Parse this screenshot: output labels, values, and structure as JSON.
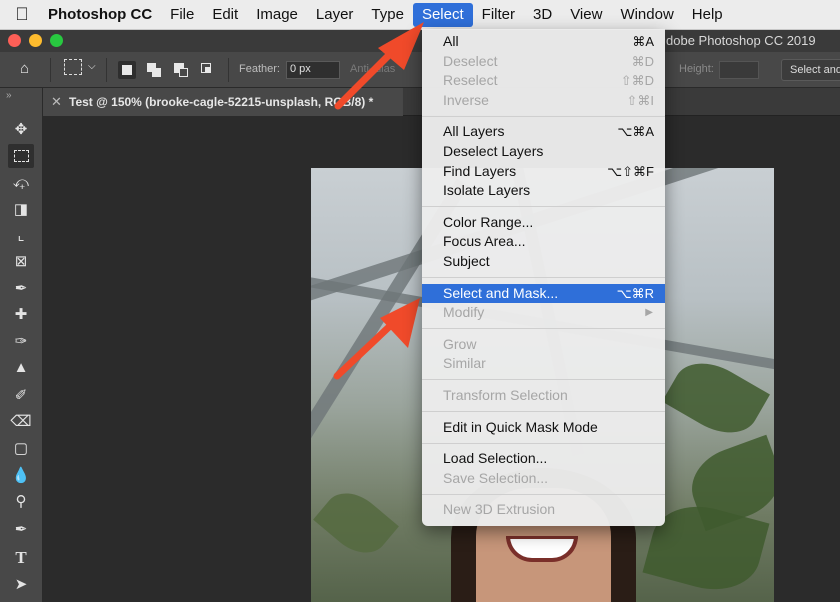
{
  "menubar": {
    "app_name": "Photoshop CC",
    "items": [
      "File",
      "Edit",
      "Image",
      "Layer",
      "Type",
      "Select",
      "Filter",
      "3D",
      "View",
      "Window",
      "Help"
    ],
    "active": "Select"
  },
  "window": {
    "title": "dobe Photoshop CC 2019"
  },
  "options": {
    "feather_label": "Feather:",
    "feather_value": "0 px",
    "antialias_label": "Anti-alias",
    "height_label": "Height:",
    "select_mask_button": "Select and Mask..."
  },
  "document": {
    "tab_title": "Test @ 150% (brooke-cagle-52215-unsplash, RGB/8) *"
  },
  "select_menu": {
    "group1": [
      {
        "label": "All",
        "shortcut": "⌘A",
        "enabled": true
      },
      {
        "label": "Deselect",
        "shortcut": "⌘D",
        "enabled": false
      },
      {
        "label": "Reselect",
        "shortcut": "⇧⌘D",
        "enabled": false
      },
      {
        "label": "Inverse",
        "shortcut": "⇧⌘I",
        "enabled": false
      }
    ],
    "group2": [
      {
        "label": "All Layers",
        "shortcut": "⌥⌘A",
        "enabled": true
      },
      {
        "label": "Deselect Layers",
        "shortcut": "",
        "enabled": true
      },
      {
        "label": "Find Layers",
        "shortcut": "⌥⇧⌘F",
        "enabled": true
      },
      {
        "label": "Isolate Layers",
        "shortcut": "",
        "enabled": true
      }
    ],
    "group3": [
      {
        "label": "Color Range...",
        "enabled": true
      },
      {
        "label": "Focus Area...",
        "enabled": true
      },
      {
        "label": "Subject",
        "enabled": true
      }
    ],
    "group4": [
      {
        "label": "Select and Mask...",
        "shortcut": "⌥⌘R",
        "enabled": true,
        "highlighted": true
      },
      {
        "label": "Modify",
        "enabled": false,
        "submenu": true
      }
    ],
    "group5": [
      {
        "label": "Grow",
        "enabled": false
      },
      {
        "label": "Similar",
        "enabled": false
      }
    ],
    "group6": [
      {
        "label": "Transform Selection",
        "enabled": false
      }
    ],
    "group7": [
      {
        "label": "Edit in Quick Mask Mode",
        "enabled": true
      }
    ],
    "group8": [
      {
        "label": "Load Selection...",
        "enabled": true
      },
      {
        "label": "Save Selection...",
        "enabled": false
      }
    ],
    "group9": [
      {
        "label": "New 3D Extrusion",
        "enabled": false
      }
    ]
  },
  "icons": {
    "apple": "apple-logo-icon",
    "home": "home-icon",
    "arrow_color": "#f04a2a",
    "highlight_color": "#2f6fd9"
  }
}
